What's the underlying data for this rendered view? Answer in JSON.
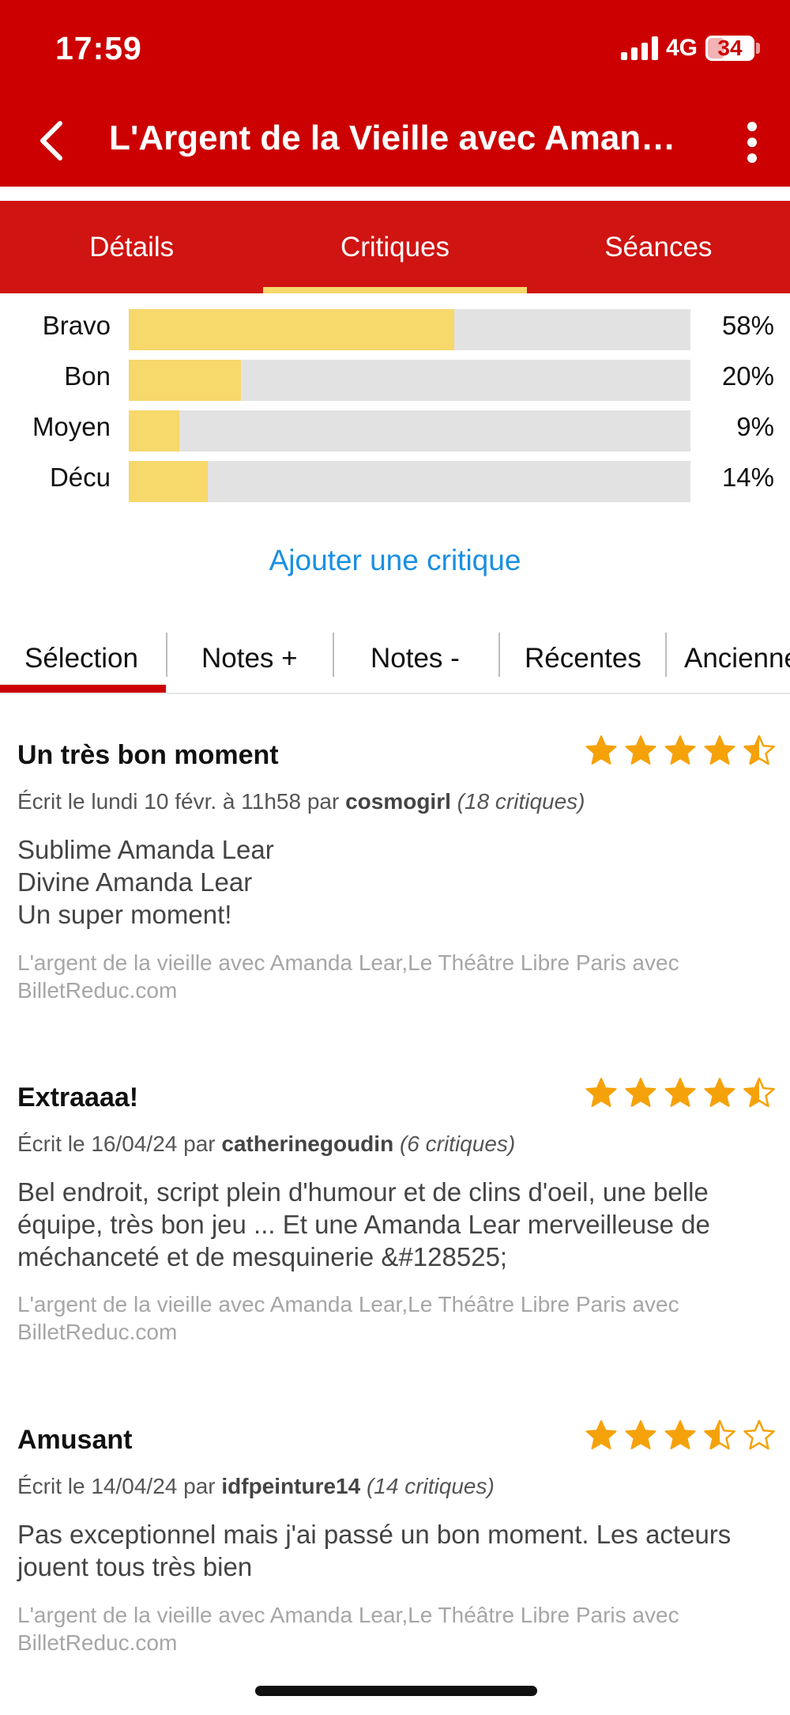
{
  "status_bar": {
    "time": "17:59",
    "network": "4G",
    "battery": "34"
  },
  "header": {
    "title": "L'Argent de la Vieille avec Amanda..."
  },
  "tabs": [
    {
      "label": "Détails",
      "active": false
    },
    {
      "label": "Critiques",
      "active": true
    },
    {
      "label": "Séances",
      "active": false
    }
  ],
  "ratings": [
    {
      "label": "Bravo",
      "percent_text": "58%",
      "percent": 58
    },
    {
      "label": "Bon",
      "percent_text": "20%",
      "percent": 20
    },
    {
      "label": "Moyen",
      "percent_text": "9%",
      "percent": 9
    },
    {
      "label": "Décu",
      "percent_text": "14%",
      "percent": 14
    }
  ],
  "add_review_label": "Ajouter une critique",
  "sort_tabs": [
    {
      "label": "Sélection",
      "active": true
    },
    {
      "label": "Notes +",
      "active": false
    },
    {
      "label": "Notes -",
      "active": false
    },
    {
      "label": "Récentes",
      "active": false
    },
    {
      "label": "Anciennes",
      "active": false
    }
  ],
  "colors": {
    "brand_red": "#cc0000",
    "tab_red": "#cf1412",
    "accent_yellow": "#f6d86b",
    "link_blue": "#1a8fe0",
    "star": "#f5a20a"
  },
  "reviews": [
    {
      "title": "Un très bon moment",
      "stars": 4.5,
      "meta_prefix": "Écrit le lundi 10 févr. à 11h58 par ",
      "author": "cosmogirl",
      "count": "(18 critiques)",
      "body": "Sublime Amanda Lear\nDivine Amanda Lear\nUn super moment!",
      "source": "L'argent de la vieille avec Amanda Lear,Le Théâtre Libre Paris avec BilletReduc.com"
    },
    {
      "title": "Extraaaa!",
      "stars": 4.5,
      "meta_prefix": "Écrit le 16/04/24 par ",
      "author": "catherinegoudin",
      "count": "(6 critiques)",
      "body": "Bel endroit, script plein d'humour et de clins d'oeil, une belle équipe, très bon jeu ... Et une Amanda Lear merveilleuse de méchanceté et de mesquinerie &#128525;",
      "source": "L'argent de la vieille avec Amanda Lear,Le Théâtre Libre Paris avec BilletReduc.com"
    },
    {
      "title": "Amusant",
      "stars": 3.5,
      "meta_prefix": "Écrit le 14/04/24 par ",
      "author": "idfpeinture14",
      "count": "(14 critiques)",
      "body": "Pas exceptionnel mais j'ai passé un bon moment. Les acteurs jouent tous très bien",
      "source": "L'argent de la vieille avec Amanda Lear,Le Théâtre Libre Paris avec BilletReduc.com"
    }
  ]
}
